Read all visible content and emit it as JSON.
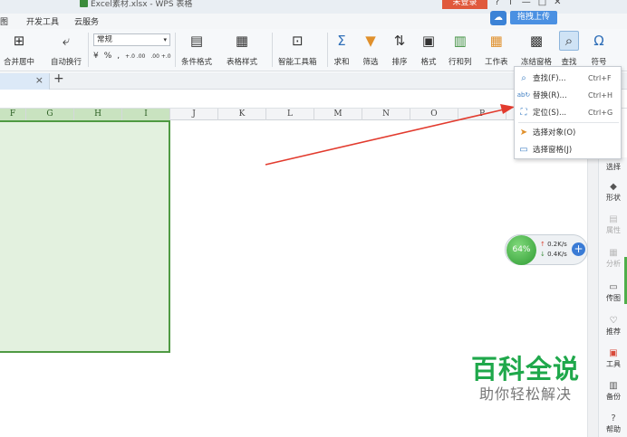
{
  "window": {
    "document_title": "Excel素材.xlsx - WPS 表格",
    "login_label": "未登录",
    "upload_label": "拖拽上传",
    "controls": [
      "?",
      "↑",
      "—",
      "□",
      "✕"
    ]
  },
  "menu": {
    "items": [
      "图",
      "开发工具",
      "云服务"
    ]
  },
  "ribbon": {
    "merge_center": "合并居中",
    "auto_wrap": "自动换行",
    "number_format": "常规",
    "percent": "%",
    "comma": ",",
    "increase_decimal": "+.0 .00",
    "decrease_decimal": ".00 +.0",
    "currency": "¥",
    "conditional_format": "条件格式",
    "table_style": "表格样式",
    "smart_toolbox": "智能工具箱",
    "sum": "求和",
    "filter": "筛选",
    "sort": "排序",
    "format": "格式",
    "row_col": "行和列",
    "worksheet": "工作表",
    "freeze": "冻结窗格",
    "find": "查找",
    "symbol": "符号"
  },
  "tabs": {
    "close": "×",
    "add": "+"
  },
  "columns": [
    "F",
    "G",
    "H",
    "I",
    "J",
    "K",
    "L",
    "M",
    "N",
    "O",
    "P"
  ],
  "dropdown": {
    "items": [
      {
        "label": "查找(F)...",
        "shortcut": "Ctrl+F",
        "icon": "magnifier-icon"
      },
      {
        "label": "替换(R)...",
        "shortcut": "Ctrl+H",
        "icon": "replace-icon"
      },
      {
        "label": "定位(S)...",
        "shortcut": "Ctrl+G",
        "icon": "locate-icon"
      },
      {
        "label": "选择对象(O)",
        "shortcut": "",
        "icon": "cursor-icon"
      },
      {
        "label": "选择窗格(J)",
        "shortcut": "",
        "icon": "pane-icon"
      }
    ]
  },
  "right_panel": {
    "items": [
      "选择",
      "形状",
      "属性",
      "分析",
      "传图",
      "推荐",
      "工具",
      "备份",
      "帮助"
    ]
  },
  "speed_widget": {
    "percent": "64%",
    "upload": "0.2K/s",
    "download": "0.4K/s",
    "plus": "+"
  },
  "watermark": {
    "title": "百科全说",
    "subtitle": "助你轻松解决"
  },
  "colors": {
    "selection_border": "#4f9a43",
    "selection_fill": "#e3f1df",
    "arrow": "#e23b2e",
    "watermark": "#1fa84b"
  }
}
